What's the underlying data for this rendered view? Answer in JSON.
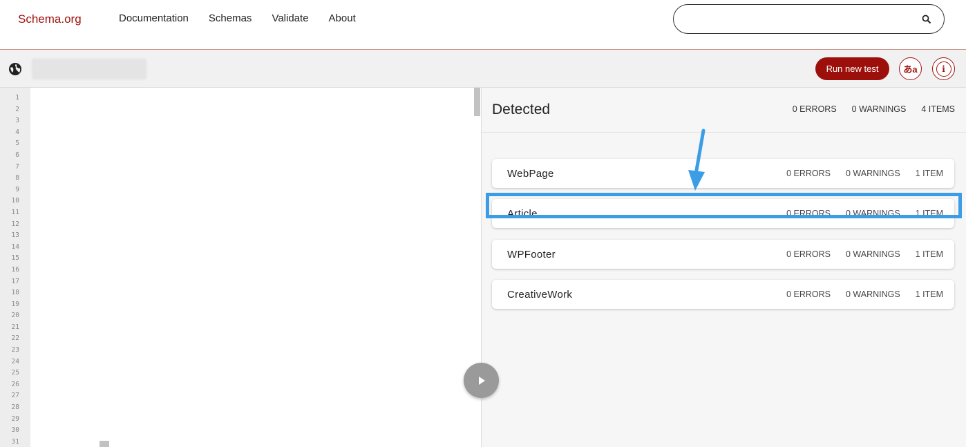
{
  "header": {
    "logo": "Schema.org",
    "nav": [
      "Documentation",
      "Schemas",
      "Validate",
      "About"
    ],
    "search": {
      "value": "",
      "placeholder": ""
    }
  },
  "toolbar": {
    "run_label": "Run new test",
    "lang_label": "あa",
    "info_label": "i"
  },
  "editor": {
    "line_numbers": [
      "1",
      "2",
      "3",
      "4",
      "5",
      "6",
      "7",
      "8",
      "9",
      "10",
      "11",
      "12",
      "13",
      "14",
      "15",
      "16",
      "17",
      "18",
      "19",
      "20",
      "21",
      "22",
      "23",
      "24",
      "25",
      "26",
      "27",
      "28",
      "29",
      "30",
      "31"
    ]
  },
  "results": {
    "title": "Detected",
    "summary": {
      "errors": "0 ERRORS",
      "warnings": "0 WARNINGS",
      "items": "4 ITEMS"
    },
    "cards": [
      {
        "name": "WebPage",
        "errors": "0 ERRORS",
        "warnings": "0 WARNINGS",
        "items": "1 ITEM"
      },
      {
        "name": "Article",
        "errors": "0 ERRORS",
        "warnings": "0 WARNINGS",
        "items": "1 ITEM"
      },
      {
        "name": "WPFooter",
        "errors": "0 ERRORS",
        "warnings": "0 WARNINGS",
        "items": "1 ITEM"
      },
      {
        "name": "CreativeWork",
        "errors": "0 ERRORS",
        "warnings": "0 WARNINGS",
        "items": "1 ITEM"
      }
    ]
  },
  "colors": {
    "brand": "#9c0f0a",
    "highlight": "#3a9de6",
    "fab": "#9a9a9a"
  },
  "icons": [
    "search-icon",
    "globe-icon",
    "play-icon",
    "info-icon",
    "translate-icon",
    "arrow-annotation-icon"
  ]
}
